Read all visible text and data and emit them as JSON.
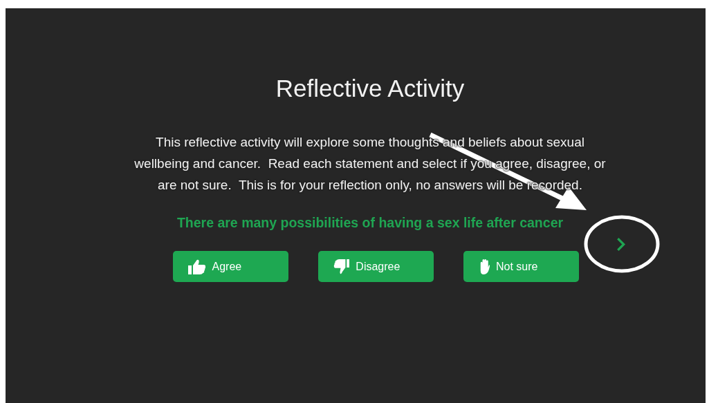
{
  "slide": {
    "title": "Reflective Activity",
    "intro": [
      "This reflective activity will explore some thoughts and beliefs about sexual",
      "wellbeing and cancer.  Read each statement and select if you agree, disagree, or",
      "are not sure.  This is for your reflection only, no answers will be recorded."
    ],
    "statement": "There are many possibilities of having a sex life after cancer",
    "buttons": [
      {
        "label": "Agree",
        "kind": "thumbs-up"
      },
      {
        "label": "Disagree",
        "kind": "thumbs-down"
      },
      {
        "label": "Not sure",
        "kind": "hand"
      }
    ],
    "next_button": {
      "kind": "chevron"
    }
  },
  "annotation": {
    "arrow": true,
    "circle": true
  }
}
